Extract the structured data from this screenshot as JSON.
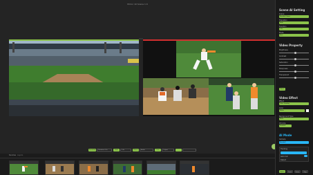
{
  "window": {
    "title": "Mirror 10 Scene 1 0"
  },
  "timeline": {
    "labels": [
      "Transition",
      "Fade",
      "Direct",
      "Live"
    ],
    "fields": [
      "Duration 0.5s",
      "0.5s",
      "Audio",
      "Output"
    ]
  },
  "strip": {
    "tab_sources": "Sources",
    "tab_layers": "Layers",
    "thumbnail_count": 6
  },
  "sidebar": {
    "scene_setting": {
      "title": "Scene AI Setting",
      "fields": [
        {
          "label": "Scene",
          "value": "Baseball Game"
        },
        {
          "label": "Transition",
          "value": "Fade"
        },
        {
          "label": "Duration",
          "value": "0.5s"
        },
        {
          "label": "Mode",
          "value": "Auto"
        }
      ]
    },
    "video_property": {
      "title": "Video Property",
      "sliders": [
        {
          "label": "Brightness",
          "level": 0.5
        },
        {
          "label": "Contrast",
          "level": 0.5
        },
        {
          "label": "Saturation",
          "level": 0.5
        },
        {
          "label": "Sharpness",
          "level": 0.5
        },
        {
          "label": "Transparent",
          "level": 0.5
        }
      ],
      "reset_label": "Reset"
    },
    "video_effect": {
      "title": "Video Effect",
      "fields": [
        {
          "label": "Effect",
          "value": "Color Grading"
        },
        {
          "label": "Color",
          "value": "White"
        },
        {
          "label": "Background Type",
          "value": "None"
        },
        {
          "label": "Chroma",
          "value": "Enabled"
        }
      ]
    },
    "ai_mode": {
      "title": "AI Mode",
      "items": [
        "Tracking",
        "Auto Cut",
        "Detect"
      ],
      "source_label": "Camera",
      "source_value": "Baseball",
      "tabs": [
        "Switch",
        "Track",
        "Focus",
        "Stop"
      ]
    }
  },
  "colors": {
    "accent": "#8bc34a",
    "program": "#d32f2f",
    "blue": "#29b6f6"
  }
}
